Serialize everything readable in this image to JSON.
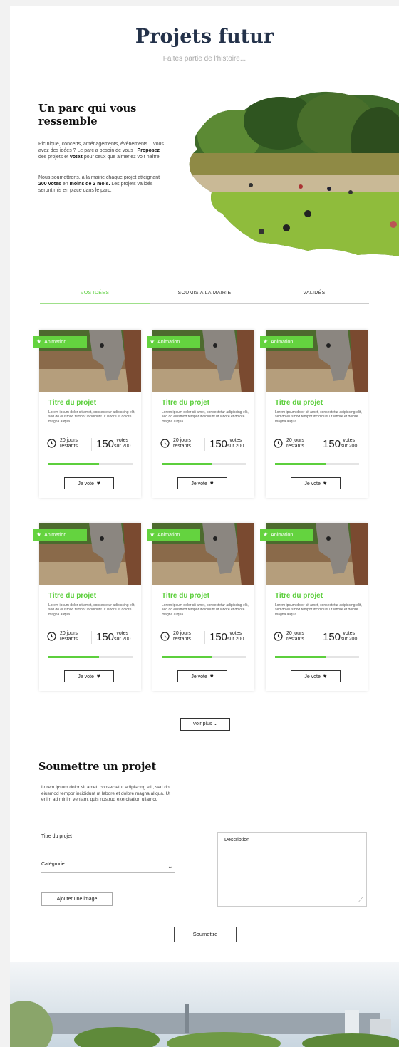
{
  "header": {
    "title": "Projets futur",
    "subtitle": "Faites partie de l'histoire..."
  },
  "intro": {
    "heading_line1": "Un parc qui vous",
    "heading_line2": "ressemble",
    "p1": "Pic nique, concerts, aménagements, évènements... vous avez des idées ? Le parc a besoin de vous !",
    "p1_bold1": "Proposez",
    "p1_mid": " des projets et ",
    "p1_bold2": "votez",
    "p1_end": " pour ceux que aimeriez voir naître.",
    "p2_start": "Nous soumettrons, à la mairie chaque projet atteignant ",
    "p2_bold1": "200 votes",
    "p2_mid": " en ",
    "p2_bold2": "moins de 2 mois.",
    "p2_end": " Les projets validés seront mis en place dans le parc."
  },
  "tabs": [
    "VOS IDÉES",
    "SOUMIS A LA MAIRIE",
    "VALIDÉS"
  ],
  "card": {
    "badge": "Animation",
    "title": "Titre du projet",
    "desc": "Lorem ipsum dolor sit amet, consectetur adipiscing elit, sed do eiusmod tempor incididunt ut labore et dolore magna aliqua.",
    "days_1": "20 jours",
    "days_2": "restants",
    "votes": "150",
    "votes_label_1": "votes",
    "votes_label_2": "sur 200",
    "progress": 0.6,
    "vote_button": "Je vote"
  },
  "load_more": "Voir plus",
  "submit_section": {
    "heading": "Soumettre un projet",
    "text": "Lorem ipsum dolor sit amet, consectetur adipiscing elit, sed do eiusmod tempor incididunt ut labore et dolore magna aliqua. Ut enim ad minim veniam, quis nostrud exercitation ullamco",
    "field_title": "Titre du projet",
    "field_category": "Catégrorie",
    "add_image": "Ajouter une image",
    "description": "Description",
    "submit": "Soumettre"
  },
  "colors": {
    "accent": "#5ccf3c",
    "title": "#24324a"
  }
}
